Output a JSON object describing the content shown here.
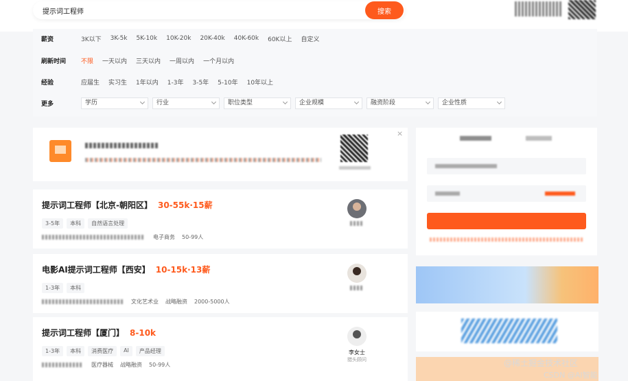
{
  "search": {
    "value": "提示词工程师",
    "button_label": "搜索"
  },
  "filters": {
    "salary": {
      "label": "薪资",
      "options": [
        "3K以下",
        "3K-5k",
        "5K-10k",
        "10K-20k",
        "20K-40k",
        "40K-60k",
        "60K以上",
        "自定义"
      ]
    },
    "refresh": {
      "label": "刷新时间",
      "options": [
        "不限",
        "一天以内",
        "三天以内",
        "一周以内",
        "一个月以内"
      ],
      "active": "不限"
    },
    "experience": {
      "label": "经验",
      "options": [
        "应届生",
        "实习生",
        "1年以内",
        "1-3年",
        "3-5年",
        "5-10年",
        "10年以上"
      ]
    },
    "more": {
      "label": "更多",
      "dropdowns": [
        "学历",
        "行业",
        "职位类型",
        "企业规模",
        "融资阶段",
        "企业性质"
      ]
    }
  },
  "ad_card": {
    "close": "×"
  },
  "jobs": [
    {
      "title": "提示词工程师【北京-朝阳区】",
      "salary": "30-55k·15薪",
      "tags": [
        "3-5年",
        "本科",
        "自然语言处理"
      ],
      "company_info": [
        "电子商务",
        "50-99人"
      ]
    },
    {
      "title": "电影AI提示词工程师【西安】",
      "salary": "10-15k·13薪",
      "tags": [
        "1-3年",
        "本科"
      ],
      "company_info": [
        "文化艺术业",
        "战略融资",
        "2000-5000人"
      ]
    },
    {
      "title": "提示词工程师【厦门】",
      "salary": "8-10k",
      "tags": [
        "1-3年",
        "本科",
        "消费医疗",
        "AI",
        "产品经理"
      ],
      "company_info": [
        "医疗器械",
        "战略融资",
        "50-99人"
      ],
      "recruiter_name": "李女士",
      "recruiter_role": "猎头顾问"
    }
  ],
  "watermark": {
    "line1": "@稀土掘金技术社区",
    "line2": "CSDN @AI智能"
  },
  "colors": {
    "accent": "#fe5a1d",
    "panel": "#f7f8fa",
    "bg": "#f5f6f8"
  }
}
